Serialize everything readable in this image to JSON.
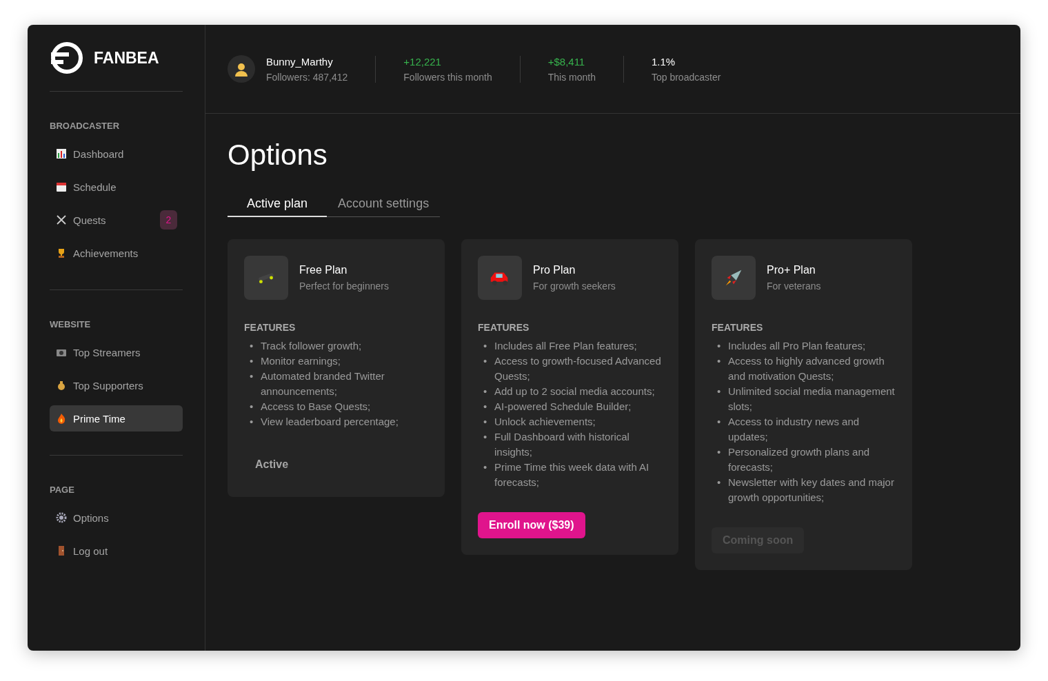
{
  "brand": {
    "name": "FANBEA"
  },
  "sidebar": {
    "sections": [
      {
        "title": "BROADCASTER",
        "items": [
          {
            "label": "Dashboard",
            "selected": false
          },
          {
            "label": "Schedule",
            "selected": false
          },
          {
            "label": "Quests",
            "selected": false,
            "badge": "2"
          },
          {
            "label": "Achievements",
            "selected": false
          }
        ]
      },
      {
        "title": "WEBSITE",
        "items": [
          {
            "label": "Top Streamers",
            "selected": false
          },
          {
            "label": "Top Supporters",
            "selected": false
          },
          {
            "label": "Prime Time",
            "selected": true
          }
        ]
      },
      {
        "title": "PAGE",
        "items": [
          {
            "label": "Options",
            "selected": false
          },
          {
            "label": "Log out",
            "selected": false
          }
        ]
      }
    ]
  },
  "header": {
    "user": {
      "name": "Bunny_Marthy",
      "followers": "Followers: 487,412"
    },
    "stats": [
      {
        "value": "+12,221",
        "label": "Followers this month",
        "positive": true
      },
      {
        "value": "+$8,411",
        "label": "This month",
        "positive": true
      },
      {
        "value": "1.1%",
        "label": "Top broadcaster",
        "positive": false
      }
    ]
  },
  "page_title": "Options",
  "tabs": [
    {
      "label": "Active plan",
      "selected": true
    },
    {
      "label": "Account settings",
      "selected": false
    }
  ],
  "plans": [
    {
      "name": "Free Plan",
      "subtitle": "Perfect for beginners",
      "features_title": "FEATURES",
      "bullet": "•",
      "features": [
        "Track follower growth;",
        "Monitor earnings;",
        "Automated branded Twitter announcements;",
        "Access to Base Quests;",
        "View leaderboard percentage;"
      ],
      "action": {
        "kind": "status",
        "label": "Active"
      }
    },
    {
      "name": "Pro Plan",
      "subtitle": "For growth seekers",
      "features_title": "FEATURES",
      "bullet": "•",
      "features": [
        "Includes all Free Plan features;",
        "Access to growth-focused Advanced Quests;",
        "Add up to 2 social media accounts;",
        "AI-powered Schedule Builder;",
        "Unlock achievements;",
        "Full Dashboard with historical insights;",
        "Prime Time this week data with AI forecasts;"
      ],
      "action": {
        "kind": "enroll",
        "label": "Enroll now ($39)"
      }
    },
    {
      "name": "Pro+ Plan",
      "subtitle": "For veterans",
      "features_title": "FEATURES",
      "bullet": "•",
      "features": [
        "Includes all Pro Plan features;",
        "Access to highly advanced growth and motivation Quests;",
        "Unlimited social media management slots;",
        "Access to industry news and updates;",
        "Personalized growth plans and forecasts;",
        "Newsletter with key dates and major growth opportunities;"
      ],
      "action": {
        "kind": "disabled",
        "label": "Coming soon"
      }
    }
  ]
}
